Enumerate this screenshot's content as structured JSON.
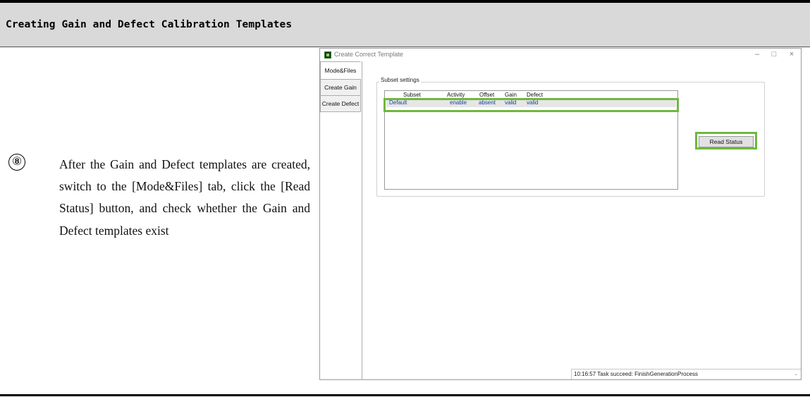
{
  "doc": {
    "header": "Creating Gain and Defect Calibration Templates",
    "step_number": "⑧",
    "step_text": "After the Gain and Defect templates are created, switch to the [Mode&Files] tab, click the [Read Status] button, and check whether the Gain and Defect templates exist"
  },
  "window": {
    "title": "Create Correct Template",
    "controls": {
      "minimize": "–",
      "maximize": "□",
      "close": "×"
    },
    "tabs": [
      {
        "label": "Mode&Files",
        "active": true
      },
      {
        "label": "Create Gain",
        "active": false
      },
      {
        "label": "Create Defect",
        "active": false
      }
    ],
    "group_label": "Subset settings",
    "table": {
      "columns": [
        "Subset",
        "Activity",
        "Offset",
        "Gain",
        "Defect"
      ],
      "rows": [
        {
          "subset": "Default",
          "activity": "enable",
          "offset": "absent",
          "gain": "valid",
          "defect": "valid"
        }
      ]
    },
    "read_status_label": "Read Status",
    "status_text": "10:16:57 Task succeed: FinishGenerationProcess",
    "status_dropdown_icon": "chevron-down-icon"
  },
  "colors": {
    "highlight": "#6fb83f",
    "header_band": "#d9d9d9",
    "row_text": "#1a3e9a"
  }
}
